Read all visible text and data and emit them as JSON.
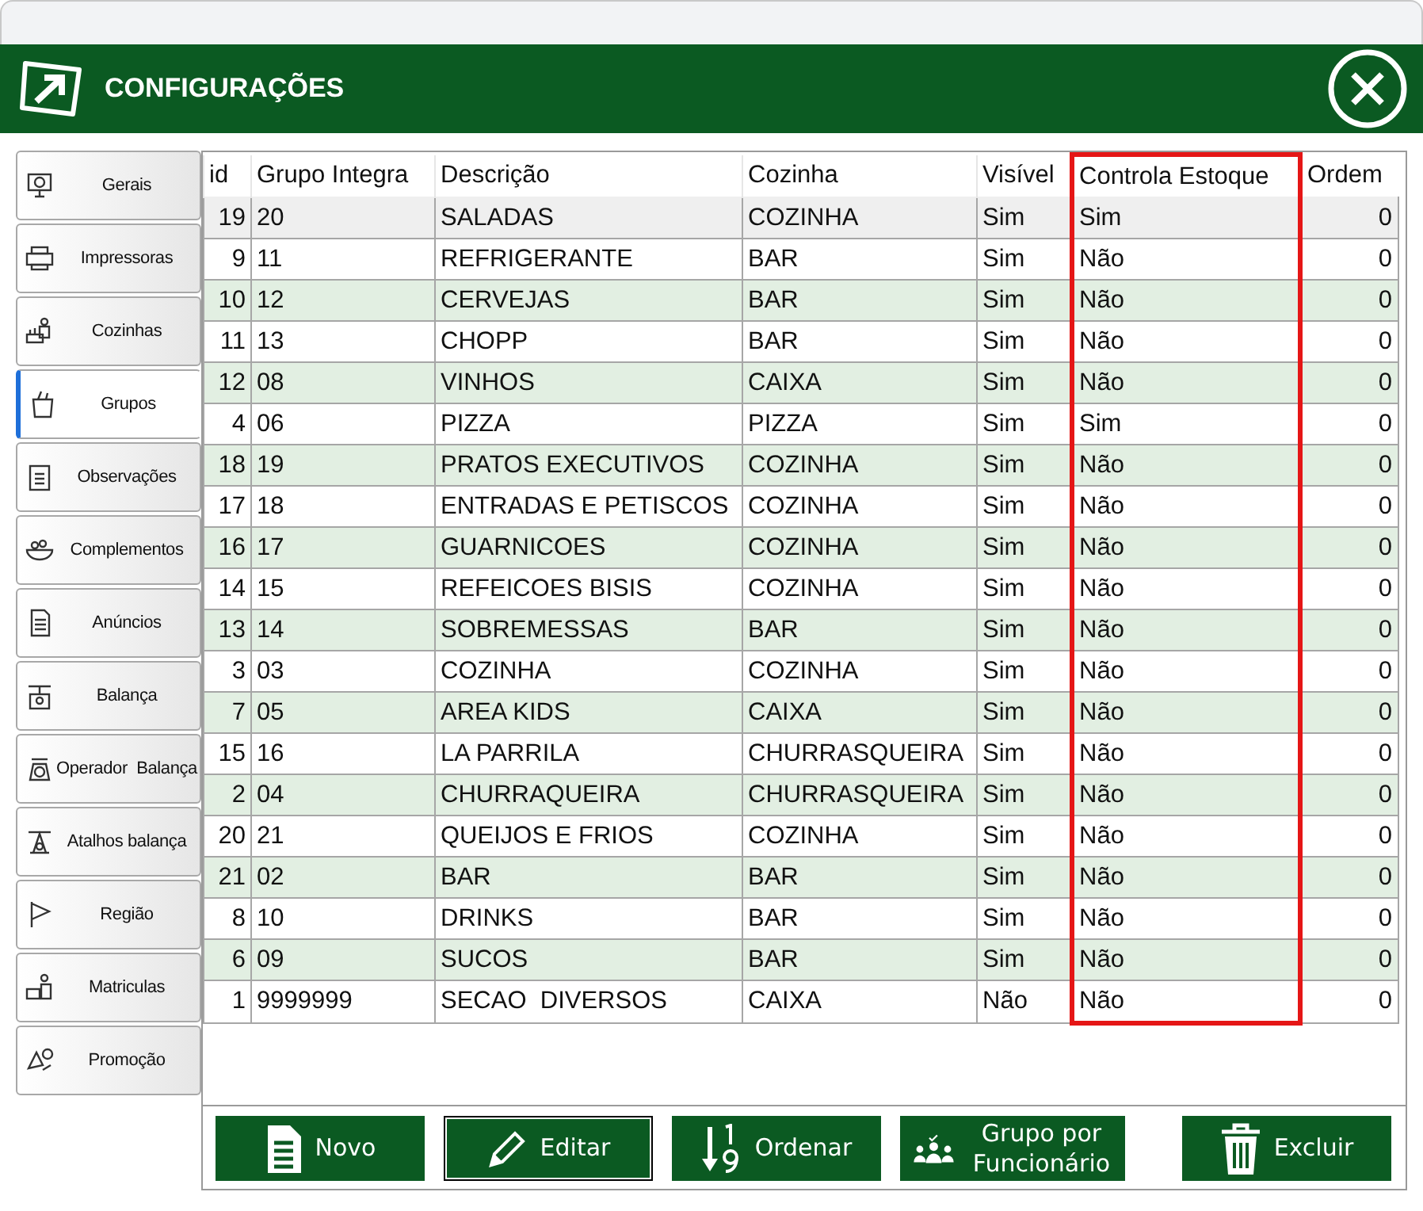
{
  "window": {
    "title": "CONFIGURAÇÕES"
  },
  "sidebar": {
    "items": [
      {
        "label": "Gerais",
        "selected": false
      },
      {
        "label": "Impressoras",
        "selected": false
      },
      {
        "label": "Cozinhas",
        "selected": false
      },
      {
        "label": "Grupos",
        "selected": true
      },
      {
        "label": "Observações",
        "selected": false
      },
      {
        "label": "Complementos",
        "selected": false
      },
      {
        "label": "Anúncios",
        "selected": false
      },
      {
        "label": "Balança",
        "selected": false
      },
      {
        "label": "Operador  Balança",
        "selected": false
      },
      {
        "label": "Atalhos balança",
        "selected": false
      },
      {
        "label": "Região",
        "selected": false
      },
      {
        "label": "Matriculas",
        "selected": false
      },
      {
        "label": "Promoção",
        "selected": false
      }
    ]
  },
  "table": {
    "columns": [
      {
        "label": "id",
        "kind": "number",
        "highlighted": false
      },
      {
        "label": "Grupo Integra",
        "kind": "text",
        "highlighted": false
      },
      {
        "label": "Descrição",
        "kind": "text",
        "highlighted": false
      },
      {
        "label": "Cozinha",
        "kind": "text",
        "highlighted": false
      },
      {
        "label": "Visível",
        "kind": "text",
        "highlighted": false
      },
      {
        "label": "Controla Estoque",
        "kind": "text",
        "highlighted": true
      },
      {
        "label": "Ordem",
        "kind": "number",
        "highlighted": false
      }
    ],
    "rows": [
      {
        "cells": [
          "19",
          "20",
          "SALADAS",
          "COZINHA",
          "Sim",
          "Sim",
          "0"
        ],
        "selected": true
      },
      {
        "cells": [
          "9",
          "11",
          "REFRIGERANTE",
          "BAR",
          "Sim",
          "Não",
          "0"
        ],
        "selected": false
      },
      {
        "cells": [
          "10",
          "12",
          "CERVEJAS",
          "BAR",
          "Sim",
          "Não",
          "0"
        ],
        "selected": false
      },
      {
        "cells": [
          "11",
          "13",
          "CHOPP",
          "BAR",
          "Sim",
          "Não",
          "0"
        ],
        "selected": false
      },
      {
        "cells": [
          "12",
          "08",
          "VINHOS",
          "CAIXA",
          "Sim",
          "Não",
          "0"
        ],
        "selected": false
      },
      {
        "cells": [
          "4",
          "06",
          "PIZZA",
          "PIZZA",
          "Sim",
          "Sim",
          "0"
        ],
        "selected": false
      },
      {
        "cells": [
          "18",
          "19",
          "PRATOS EXECUTIVOS",
          "COZINHA",
          "Sim",
          "Não",
          "0"
        ],
        "selected": false
      },
      {
        "cells": [
          "17",
          "18",
          "ENTRADAS E PETISCOS",
          "COZINHA",
          "Sim",
          "Não",
          "0"
        ],
        "selected": false
      },
      {
        "cells": [
          "16",
          "17",
          "GUARNICOES",
          "COZINHA",
          "Sim",
          "Não",
          "0"
        ],
        "selected": false
      },
      {
        "cells": [
          "14",
          "15",
          "REFEICOES BISIS",
          "COZINHA",
          "Sim",
          "Não",
          "0"
        ],
        "selected": false
      },
      {
        "cells": [
          "13",
          "14",
          "SOBREMESSAS",
          "BAR",
          "Sim",
          "Não",
          "0"
        ],
        "selected": false
      },
      {
        "cells": [
          "3",
          "03",
          "COZINHA",
          "COZINHA",
          "Sim",
          "Não",
          "0"
        ],
        "selected": false
      },
      {
        "cells": [
          "7",
          "05",
          "AREA KIDS",
          "CAIXA",
          "Sim",
          "Não",
          "0"
        ],
        "selected": false
      },
      {
        "cells": [
          "15",
          "16",
          "LA PARRILA",
          "CHURRASQUEIRA",
          "Sim",
          "Não",
          "0"
        ],
        "selected": false
      },
      {
        "cells": [
          "2",
          "04",
          "CHURRAQUEIRA",
          "CHURRASQUEIRA",
          "Sim",
          "Não",
          "0"
        ],
        "selected": false
      },
      {
        "cells": [
          "20",
          "21",
          "QUEIJOS E FRIOS",
          "COZINHA",
          "Sim",
          "Não",
          "0"
        ],
        "selected": false
      },
      {
        "cells": [
          "21",
          "02",
          "BAR",
          "BAR",
          "Sim",
          "Não",
          "0"
        ],
        "selected": false
      },
      {
        "cells": [
          "8",
          "10",
          "DRINKS",
          "BAR",
          "Sim",
          "Não",
          "0"
        ],
        "selected": false
      },
      {
        "cells": [
          "6",
          "09",
          "SUCOS",
          "BAR",
          "Sim",
          "Não",
          "0"
        ],
        "selected": false
      },
      {
        "cells": [
          "1",
          "9999999",
          "SECAO  DIVERSOS",
          "CAIXA",
          "Não",
          "Não",
          "0"
        ],
        "selected": false
      }
    ]
  },
  "buttons": [
    {
      "label": "Novo",
      "focused": false
    },
    {
      "label": "Editar",
      "focused": true
    },
    {
      "label": "Ordenar",
      "focused": false
    },
    {
      "label": "Grupo por Funcionário",
      "focused": false
    },
    {
      "label": "Excluir",
      "focused": false
    }
  ]
}
